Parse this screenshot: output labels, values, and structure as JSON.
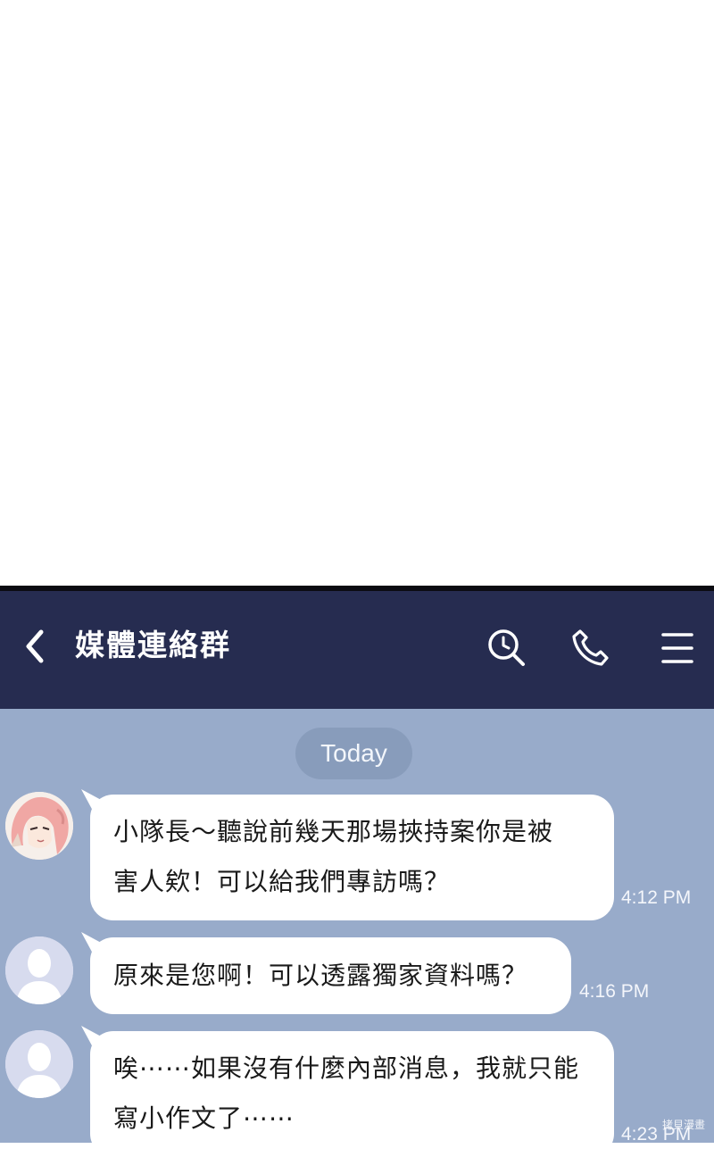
{
  "header": {
    "title": "媒體連絡群",
    "background": "#262c50",
    "back_icon": "chevron-left-icon",
    "search_icon": "search-icon",
    "call_icon": "phone-icon",
    "menu_icon": "hamburger-menu-icon"
  },
  "chat": {
    "background": "#98abca",
    "date_label": "Today",
    "messages": [
      {
        "avatar": "pink-hair-character-avatar",
        "lines": [
          "小隊長～聽說前幾天那場挾持案你是被",
          "害人欸！可以給我們專訪嗎？"
        ],
        "time": "4:12 PM"
      },
      {
        "avatar": "default-person-avatar",
        "lines": [
          "原來是您啊！可以透露獨家資料嗎？"
        ],
        "time": "4:16 PM"
      },
      {
        "avatar": "default-person-avatar",
        "lines": [
          "唉⋯⋯如果沒有什麼內部消息，我就只能",
          "寫小作文了⋯⋯"
        ],
        "time": "4:23 PM"
      }
    ]
  },
  "watermark": "拷貝漫畫"
}
